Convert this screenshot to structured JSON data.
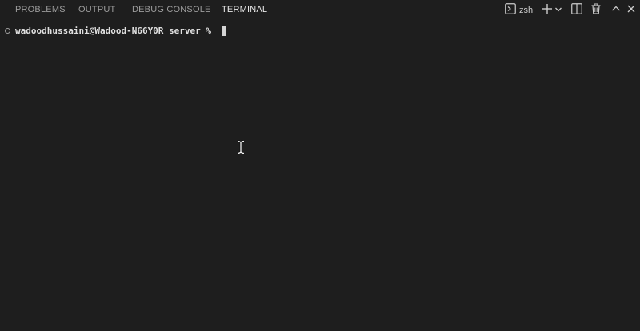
{
  "tabs": {
    "problems": "PROBLEMS",
    "output": "OUTPUT",
    "debug_console": "DEBUG CONSOLE",
    "terminal": "TERMINAL",
    "active": "terminal"
  },
  "toolbar": {
    "shell_name": "zsh",
    "icons": [
      "terminal-icon",
      "plus-icon",
      "chevron-down-icon",
      "split-terminal-icon",
      "trash-icon",
      "chevron-up-icon",
      "close-icon"
    ]
  },
  "terminal": {
    "prompt": "wadoodhussaini@Wadood-N66Y0R server % "
  },
  "colors": {
    "background": "#1e1e1e",
    "tab_inactive": "#9d9d9d",
    "tab_active": "#e7e7e7",
    "text": "#e0e0e0"
  }
}
